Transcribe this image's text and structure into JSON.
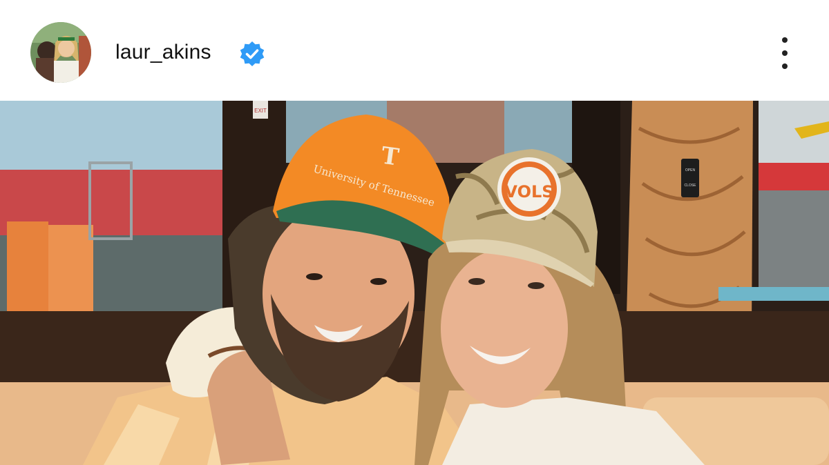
{
  "post": {
    "username": "laur_akins",
    "verified": true,
    "avatar_icon": "profile-avatar",
    "more_icon": "more-vertical-icon"
  },
  "photo": {
    "scene_text": {
      "exit_sign": "EXIT",
      "hat_left": "University of Tennessee",
      "hat_left_logo": "T",
      "hat_right_patch": "VOLS",
      "switch_top": "OPEN",
      "switch_bottom": "CLOSE"
    }
  },
  "colors": {
    "verified_blue": "#2f9bf7",
    "text": "#111111",
    "tennessee_orange": "#f38a25"
  }
}
